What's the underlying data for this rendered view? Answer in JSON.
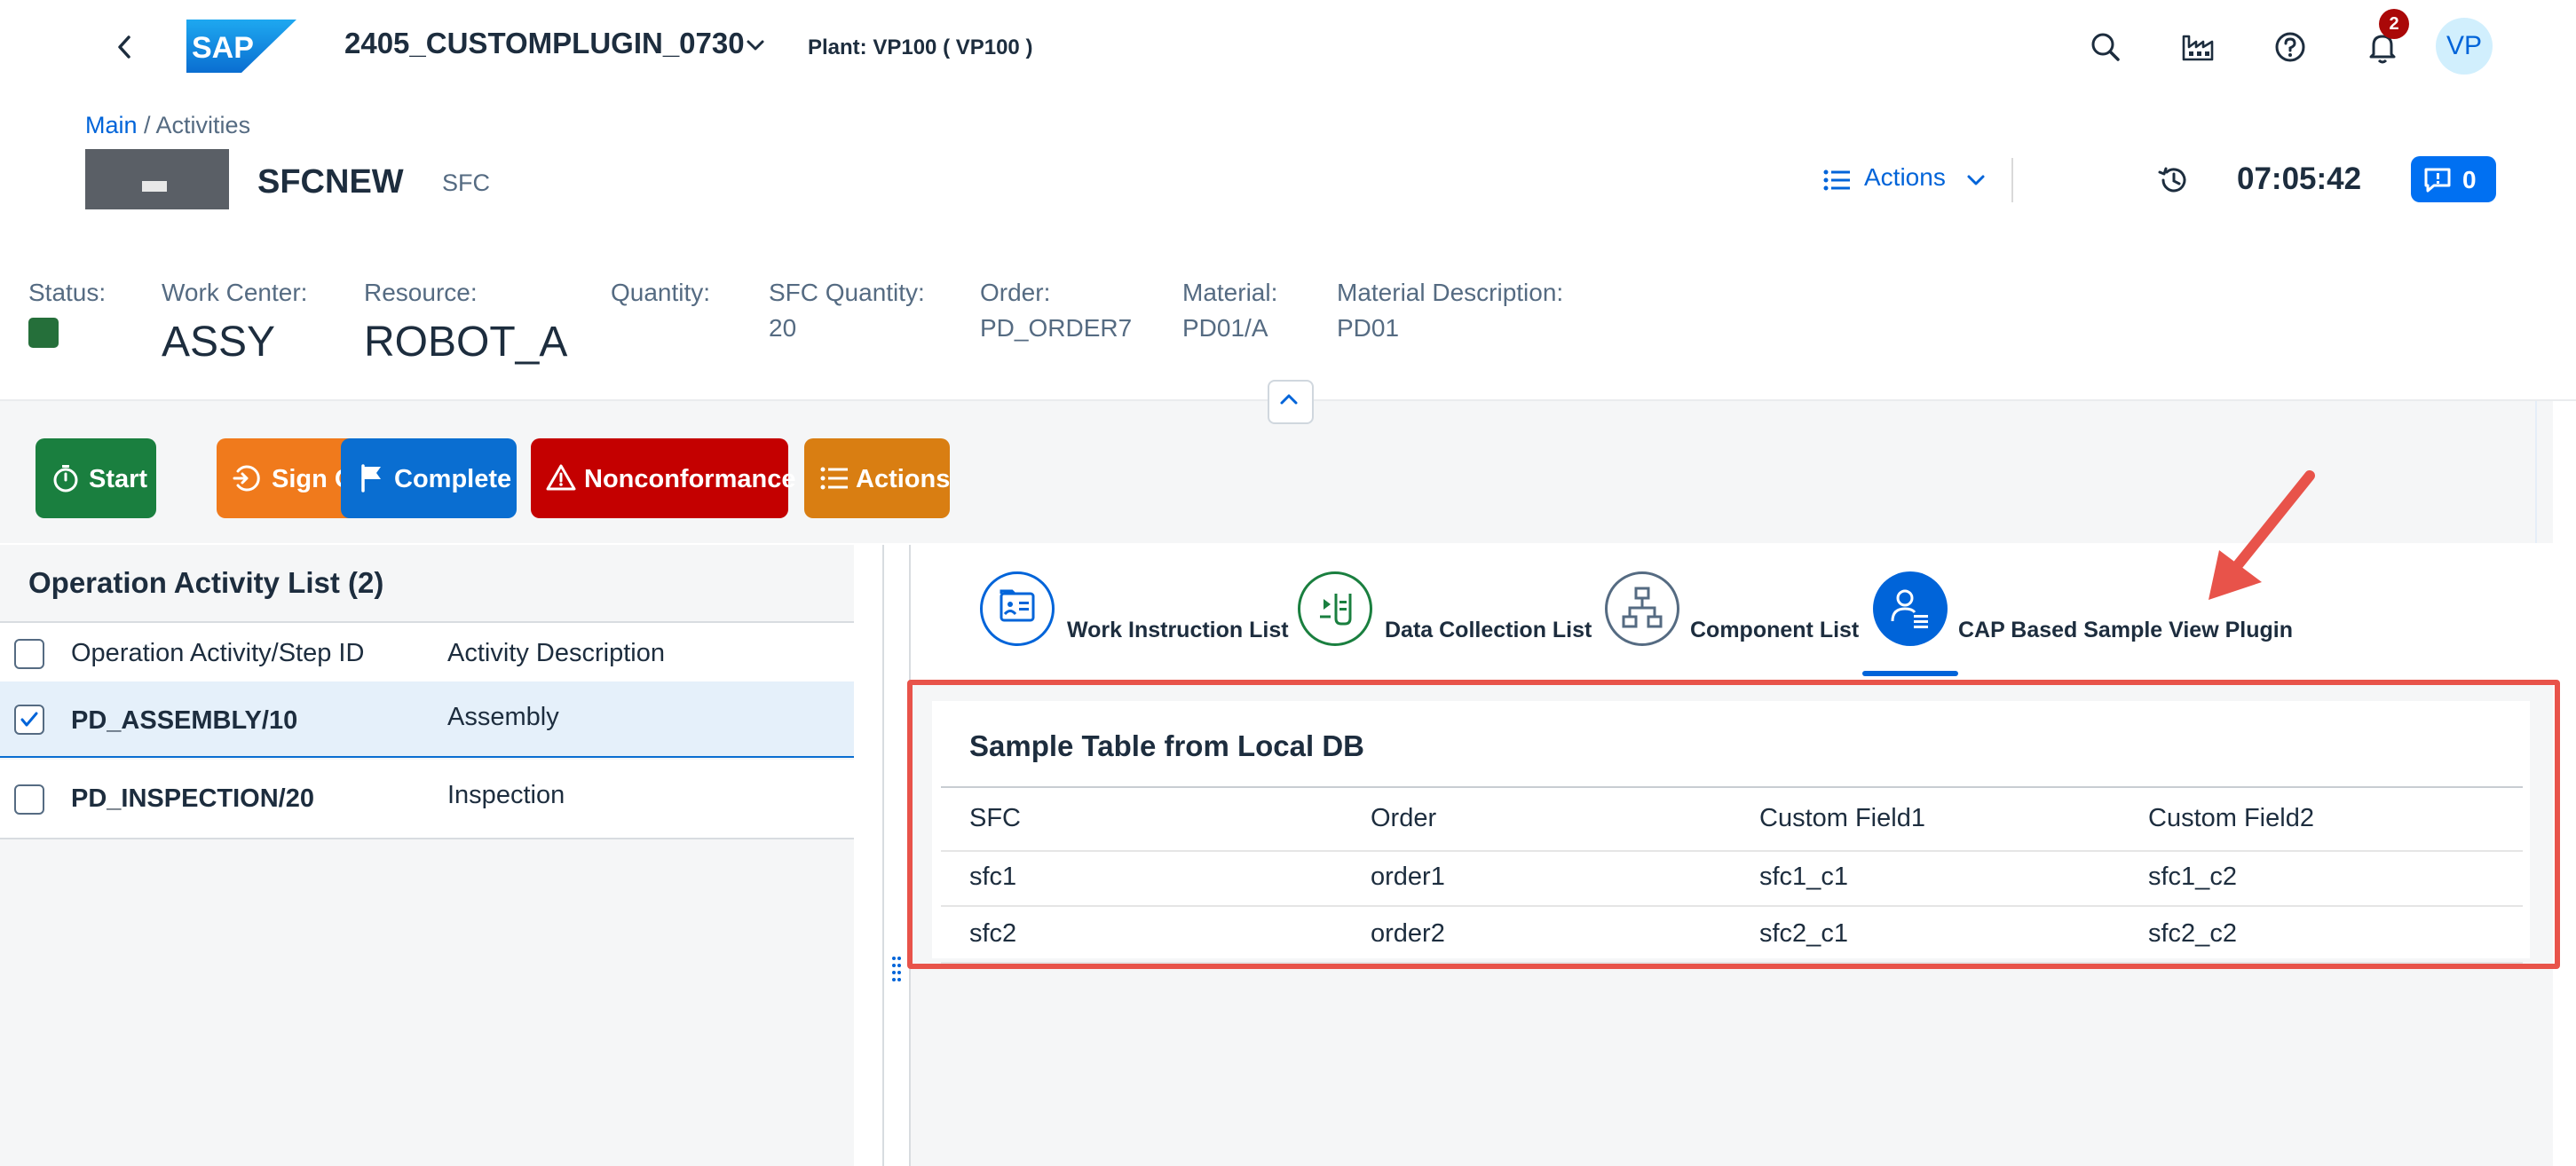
{
  "shell": {
    "app_title": "2405_CUSTOMPLUGIN_0730",
    "plant": "Plant: VP100 ( VP100 )",
    "logo_text": "SAP",
    "notification_count": "2",
    "avatar_initials": "VP"
  },
  "breadcrumb": {
    "main": "Main",
    "separator": " / ",
    "current": "Activities"
  },
  "object": {
    "title": "SFCNEW",
    "subtitle": "SFC",
    "actions_label": "Actions",
    "clock": "07:05:42",
    "messages_count": "0"
  },
  "attributes": {
    "status_label": "Status:",
    "status_color": "#256f3a",
    "work_center_label": "Work Center:",
    "work_center": "ASSY",
    "resource_label": "Resource:",
    "resource": "ROBOT_A",
    "quantity_label": "Quantity:",
    "quantity": "",
    "sfc_quantity_label": "SFC Quantity:",
    "sfc_quantity": "20",
    "order_label": "Order:",
    "order": "PD_ORDER7",
    "material_label": "Material:",
    "material": "PD01/A",
    "material_desc_label": "Material Description:",
    "material_desc": "PD01"
  },
  "toolbar": {
    "start": "Start",
    "sign_off": "Sign Off",
    "complete": "Complete",
    "nonconformance": "Nonconformance",
    "actions": "Actions",
    "colors": {
      "start": "#1a7f3f",
      "sign_off": "#f07a1c",
      "complete": "#0a6ed1",
      "nonconformance": "#c40000",
      "actions": "#d97e12"
    }
  },
  "activity_list": {
    "title": "Operation Activity List (2)",
    "columns": [
      "Operation Activity/Step ID",
      "Activity Description"
    ],
    "rows": [
      {
        "id": "PD_ASSEMBLY/10",
        "desc": "Assembly",
        "checked": true
      },
      {
        "id": "PD_INSPECTION/20",
        "desc": "Inspection",
        "checked": false
      }
    ]
  },
  "tabs": [
    {
      "label": "Work Instruction List",
      "icon": "work-instruction-icon"
    },
    {
      "label": "Data Collection List",
      "icon": "data-collection-icon"
    },
    {
      "label": "Component List",
      "icon": "component-hierarchy-icon"
    },
    {
      "label": "CAP Based Sample View Plugin",
      "icon": "user-list-icon",
      "selected": true
    }
  ],
  "sample_table": {
    "title": "Sample Table from Local DB",
    "columns": [
      "SFC",
      "Order",
      "Custom Field1",
      "Custom Field2"
    ],
    "rows": [
      [
        "sfc1",
        "order1",
        "sfc1_c1",
        "sfc1_c2"
      ],
      [
        "sfc2",
        "order2",
        "sfc2_c1",
        "sfc2_c2"
      ]
    ]
  },
  "colors": {
    "accent": "#0064d9",
    "highlight": "#e8534a"
  }
}
